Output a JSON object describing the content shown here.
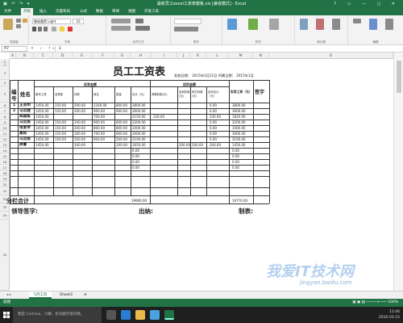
{
  "app": {
    "title": "最新员工excel工资表模板.xls [兼容模式] - Excel",
    "qat": "▣ ↶ ↷ ▾",
    "window_controls": "? ▭ — ▢ ✕"
  },
  "tabs": [
    "文件",
    "开始",
    "插入",
    "页面布局",
    "公式",
    "数据",
    "审阅",
    "视图",
    "开发工具"
  ],
  "ribbon": {
    "font_name": "微软雅黑 Light",
    "font_size": "10",
    "groups": [
      "剪贴板",
      "字体",
      "对齐方式",
      "数字",
      "样式",
      "单元格",
      "编辑"
    ]
  },
  "formula_bar": {
    "name_box": "A7",
    "fx_icons": "✕ ✓ fx",
    "value": "2"
  },
  "columns": [
    "A",
    "B",
    "C",
    "D",
    "E",
    "F",
    "G",
    "H",
    "I",
    "J",
    "K",
    "L",
    "M",
    "N",
    "O"
  ],
  "rows": [
    "1",
    "2",
    "3",
    "4",
    "5",
    "6",
    "7",
    "8",
    "9",
    "10",
    "11",
    "12",
    "13",
    "14",
    "15",
    "16",
    "17",
    "18",
    "19",
    "20",
    "21",
    "22",
    "23",
    "24",
    "25"
  ],
  "sheet": {
    "title": "员工工资表",
    "issue_date": "发放日期： 2015年2月12日  所属日期： 2015年1月",
    "h_no": "编号",
    "h_name": "姓名",
    "h_payable": "应发金额",
    "h_deduct": "应扣金额",
    "h_net": "实发工资（元）",
    "h_sign": "签字",
    "sub": [
      "基本工资",
      "全勤奖",
      "补助",
      "岗位",
      "奖金",
      "合计（元）",
      "请假扣款(元)",
      "迟到扣款(元)",
      "其它扣款(元)",
      "应扣合计（元）"
    ],
    "rows": [
      [
        "1",
        "王亚明",
        "1450.00",
        "150.00",
        "200.00",
        "1200.00",
        "800.00",
        "3800.00",
        "",
        "",
        "",
        "0.00",
        "3800.00"
      ],
      [
        "2",
        "马云鹿",
        "1450.00",
        "150.00",
        "200.00",
        "900.00",
        "900.00",
        "3600.00",
        "",
        "",
        "",
        "0.00",
        "3600.00"
      ],
      [
        "",
        "郑国栋",
        "1450.00",
        "",
        "",
        "700.00",
        "",
        "2150.00",
        "330.00",
        "",
        "",
        "330.00",
        "1820.00"
      ],
      [
        "",
        "马云南",
        "1450.00",
        "150.00",
        "100.00",
        "900.00",
        "600.00",
        "3200.00",
        "",
        "",
        "",
        "0.00",
        "3200.00"
      ],
      [
        "",
        "张爱琴",
        "1450.00",
        "150.00",
        "200.00",
        "800.00",
        "800.00",
        "3400.00",
        "",
        "",
        "",
        "0.00",
        "3400.00"
      ],
      [
        "",
        "高阳",
        "1450.00",
        "150.00",
        "100.00",
        "700.00",
        "600.00",
        "3000.00",
        "",
        "",
        "",
        "0.00",
        "3000.00"
      ],
      [
        "",
        "马云丽",
        "1450.00",
        "150.00",
        "100.00",
        "900.00",
        "500.00",
        "3100.00",
        "",
        "",
        "",
        "0.00",
        "3100.00"
      ],
      [
        "",
        "周睿",
        "1450.00",
        "",
        "100.00",
        "",
        "100.00",
        "1650.00",
        "",
        "200.00",
        "200.00",
        "200.00",
        "1450.00"
      ],
      [
        "",
        "",
        "",
        "",
        "",
        "",
        "",
        "0.00",
        "",
        "",
        "",
        "",
        "0.00"
      ],
      [
        "",
        "",
        "",
        "",
        "",
        "",
        "",
        "0.00",
        "",
        "",
        "",
        "",
        "0.00"
      ],
      [
        "",
        "",
        "",
        "",
        "",
        "",
        "",
        "0.00",
        "",
        "",
        "",
        "",
        "0.00"
      ],
      [
        "",
        "",
        "",
        "",
        "",
        "",
        "",
        "0.00",
        "",
        "",
        "",
        "",
        "0.00"
      ]
    ],
    "subtotal_label": "分栏合计",
    "subtotal_total": "19900.00",
    "subtotal_net": "19770.00",
    "leader_sign": "领导签字:",
    "cashier": "出纳:",
    "preparer": "制表:"
  },
  "sheet_tabs": [
    "5月工资",
    "Sheet3",
    "⊕"
  ],
  "status": {
    "left": "就绪",
    "right": "▦ ▣ ▤  ─────+─── 100%"
  },
  "taskbar": {
    "search": "我是 Cortana，小娜。有问题尽管问我。",
    "time": "13:46",
    "date": "2016-03-15"
  },
  "watermark": {
    "text": "我爱IT技术网",
    "url": "jingyan.baidu.com"
  },
  "colors": {
    "excel_green": "#217346",
    "taskbar": "#1f1f1f"
  }
}
